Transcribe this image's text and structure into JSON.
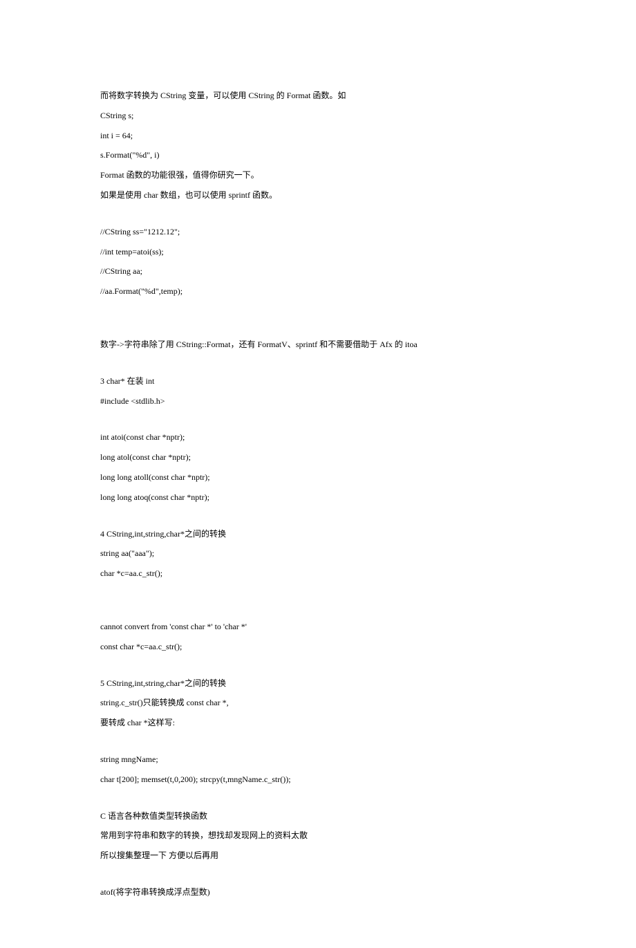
{
  "lines": [
    "而将数字转换为 CString 变量，可以使用 CString 的 Format 函数。如",
    "CString s;",
    "int i = 64;",
    "s.Format(\"%d\", i)",
    "Format 函数的功能很强，值得你研究一下。",
    "如果是使用 char 数组，也可以使用 sprintf 函数。",
    "",
    "//CString ss=\"1212.12\";",
    "//int temp=atoi(ss);",
    "//CString aa;",
    "//aa.Format(\"%d\",temp);",
    "",
    "",
    "数字->字符串除了用 CString::Format，还有 FormatV、sprintf 和不需要借助于 Afx 的 itoa",
    "",
    "3 char* 在装 int",
    "#include <stdlib.h>",
    "",
    "int atoi(const char *nptr);",
    "long atol(const char *nptr);",
    "long long atoll(const char *nptr);",
    "long long atoq(const char *nptr);",
    "",
    "4 CString,int,string,char*之间的转换",
    "string aa(\"aaa\");",
    "char *c=aa.c_str();",
    "",
    "",
    "cannot convert from 'const char *' to 'char *'",
    "const char *c=aa.c_str();",
    "",
    "5 CString,int,string,char*之间的转换",
    "string.c_str()只能转换成 const char *,",
    "要转成 char *这样写:",
    "",
    "string mngName;",
    "char t[200]; memset(t,0,200); strcpy(t,mngName.c_str());",
    "",
    "C 语言各种数值类型转换函数",
    "常用到字符串和数字的转换，想找却发现网上的资料太散",
    "所以搜集整理一下 方便以后再用",
    "",
    "atof(将字符串转换成浮点型数)"
  ]
}
